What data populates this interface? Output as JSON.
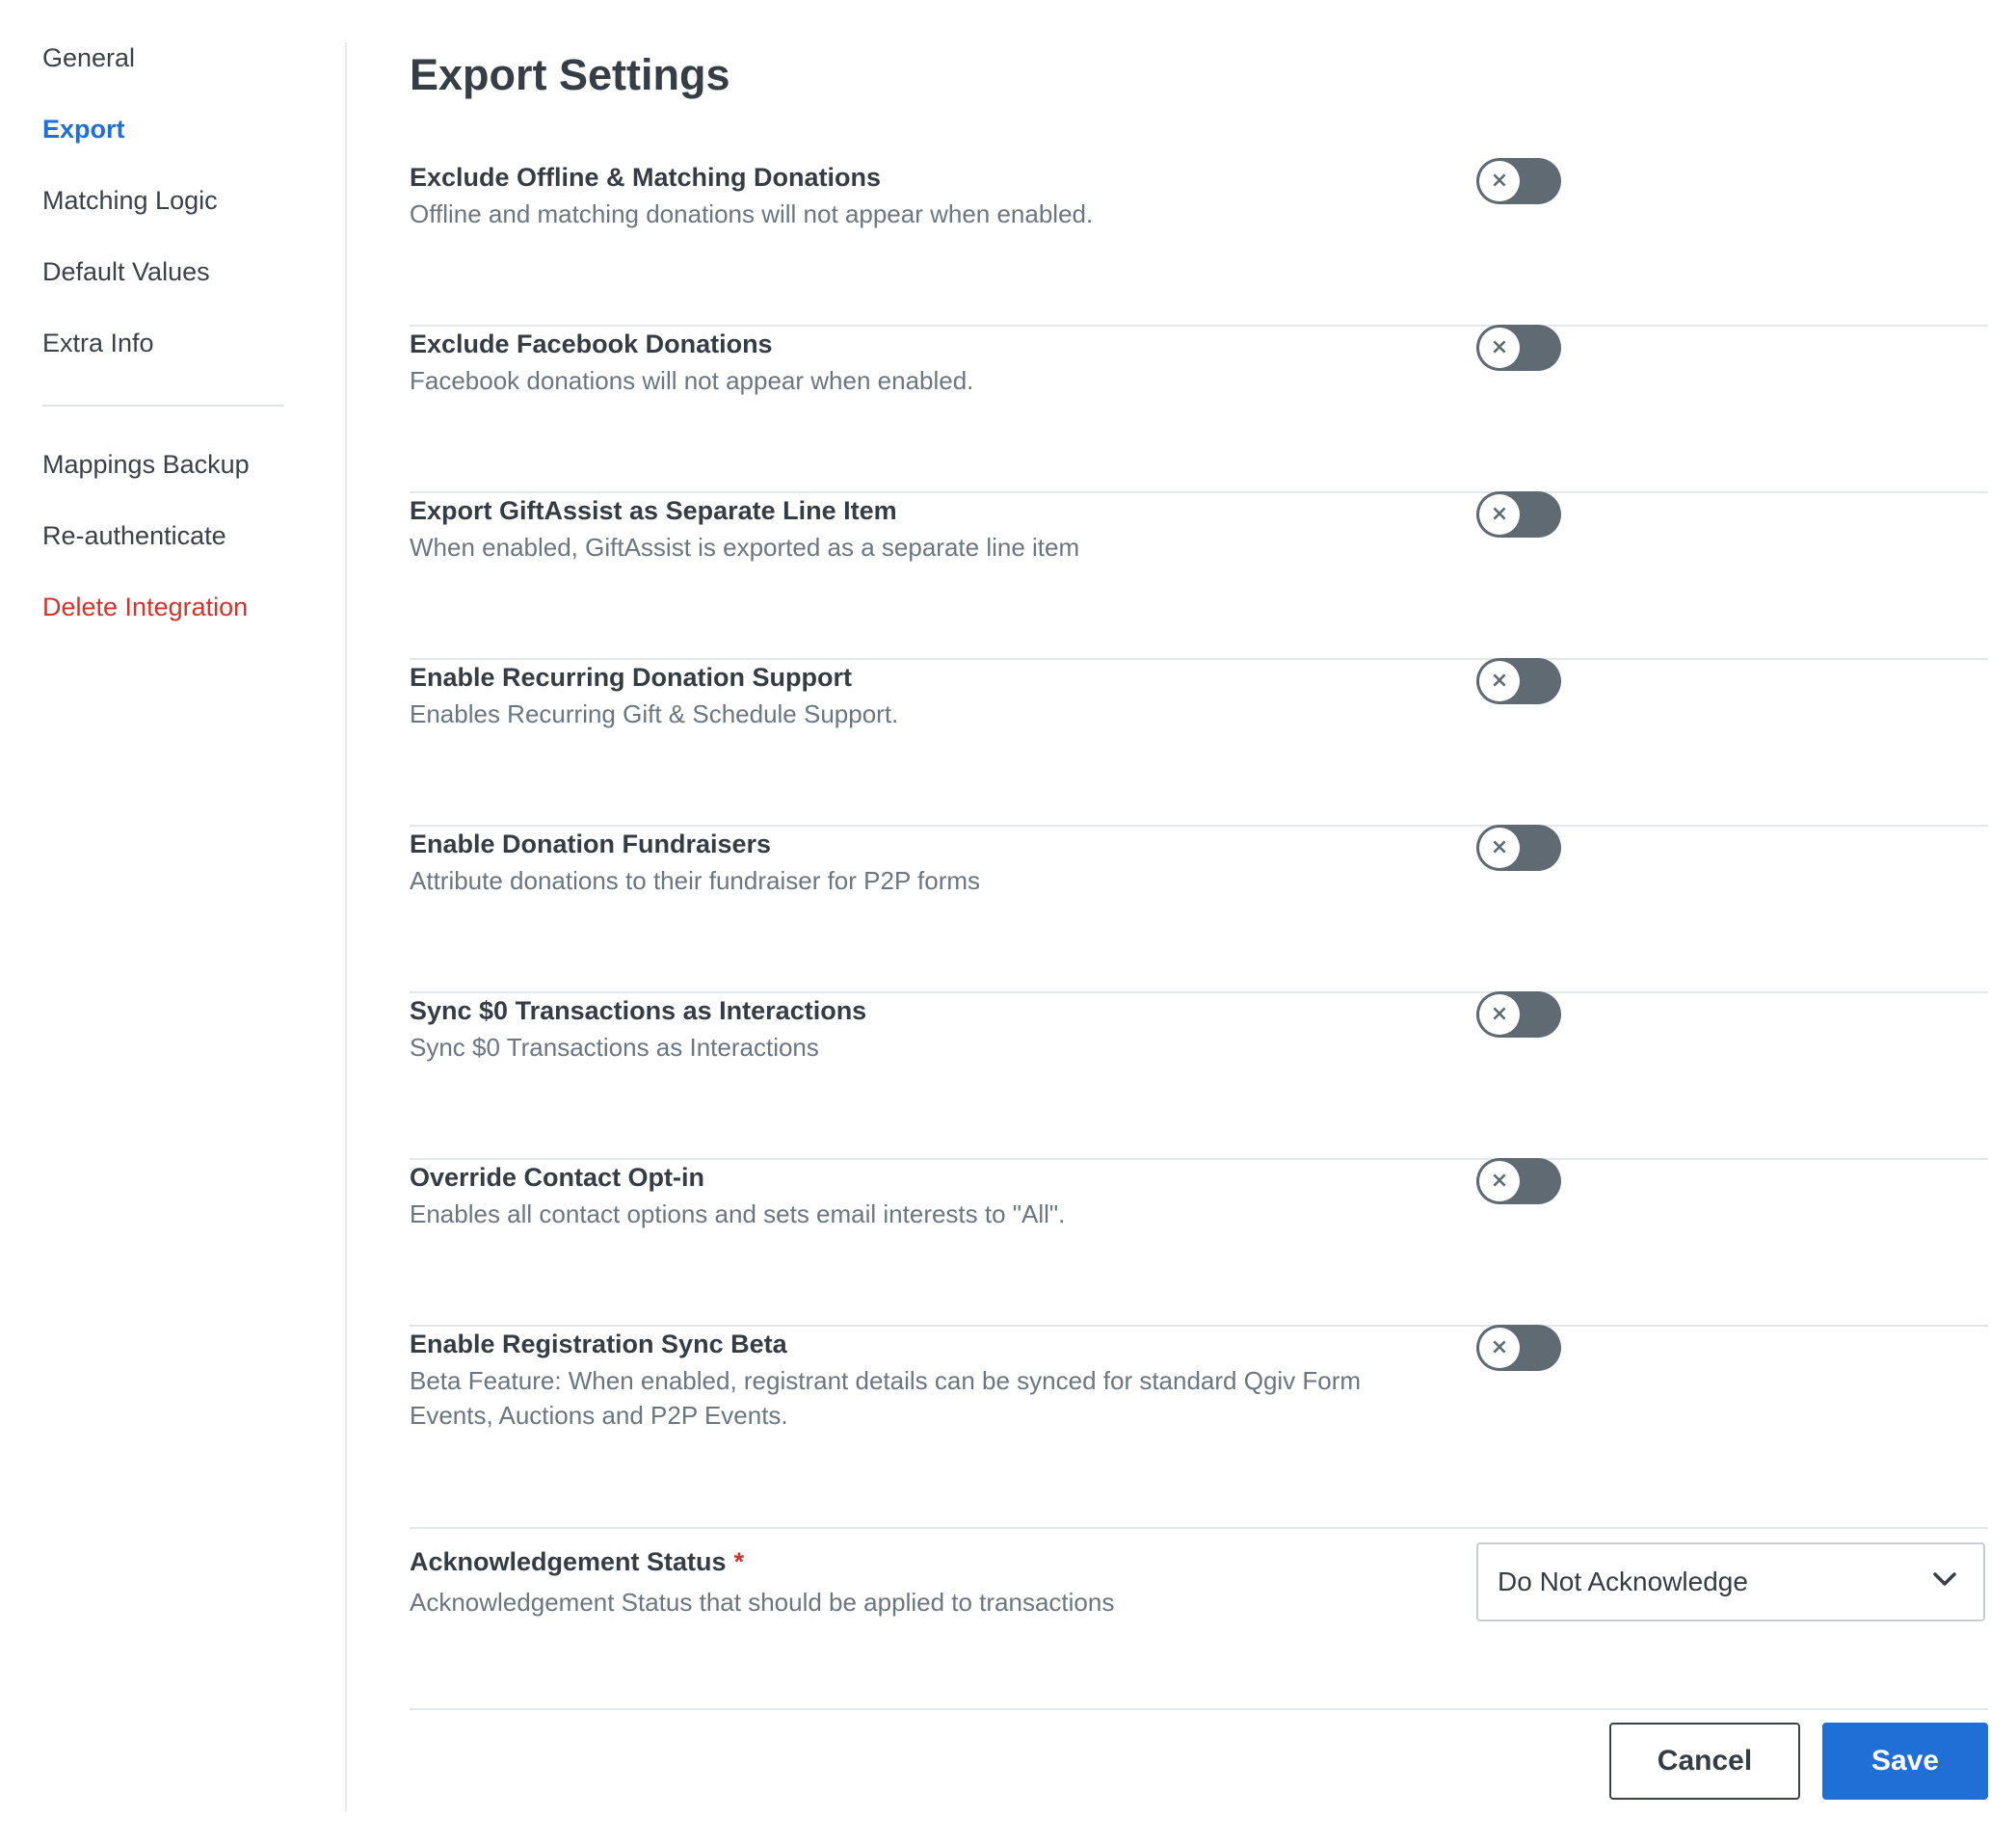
{
  "sidebar": {
    "primary": [
      {
        "label": "General"
      },
      {
        "label": "Export"
      },
      {
        "label": "Matching Logic"
      },
      {
        "label": "Default Values"
      },
      {
        "label": "Extra Info"
      }
    ],
    "secondary": [
      {
        "label": "Mappings Backup"
      },
      {
        "label": "Re-authenticate"
      },
      {
        "label": "Delete Integration"
      }
    ],
    "active_item": "Export"
  },
  "page": {
    "title": "Export Settings"
  },
  "settings": [
    {
      "title": "Exclude Offline & Matching Donations",
      "description": "Offline and matching donations will not appear when enabled.",
      "enabled": false
    },
    {
      "title": "Exclude Facebook Donations",
      "description": "Facebook donations will not appear when enabled.",
      "enabled": false
    },
    {
      "title": "Export GiftAssist as Separate Line Item",
      "description": "When enabled, GiftAssist is exported as a separate line item",
      "enabled": false
    },
    {
      "title": "Enable Recurring Donation Support",
      "description": "Enables Recurring Gift & Schedule Support.",
      "enabled": false
    },
    {
      "title": "Enable Donation Fundraisers",
      "description": "Attribute donations to their fundraiser for P2P forms",
      "enabled": false
    },
    {
      "title": "Sync $0 Transactions as Interactions",
      "description": "Sync $0 Transactions as Interactions",
      "enabled": false
    },
    {
      "title": "Override Contact Opt-in",
      "description": "Enables all contact options and sets email interests to \"All\".",
      "enabled": false
    },
    {
      "title": "Enable Registration Sync Beta",
      "description": "Beta Feature: When enabled, registrant details can be synced for standard Qgiv Form Events, Auctions and P2P Events.",
      "enabled": false
    }
  ],
  "toggle_off_glyph": "×",
  "acknowledgement": {
    "title": "Acknowledgement Status",
    "required_marker": "*",
    "description": "Acknowledgement Status that should be applied to transactions",
    "selected": "Do Not Acknowledge"
  },
  "actions": {
    "cancel_label": "Cancel",
    "save_label": "Save"
  },
  "colors": {
    "accent": "#1f6fd6",
    "danger": "#d0342c",
    "toggle_off": "#5f6a73"
  }
}
